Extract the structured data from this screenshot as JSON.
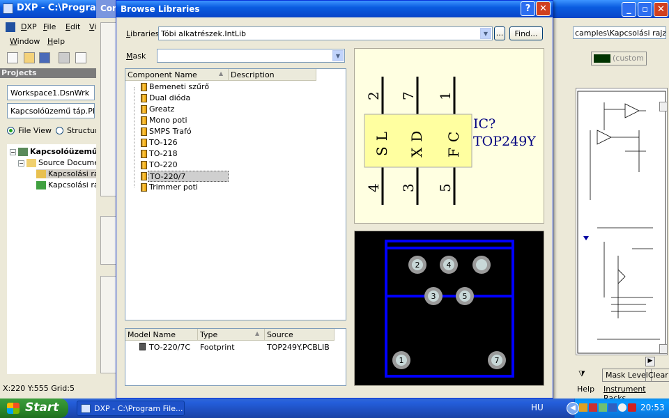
{
  "app": {
    "title": "DXP - C:\\Program",
    "menu": [
      "DXP",
      "File",
      "Edit",
      "Vi",
      "Window",
      "Help"
    ],
    "bg_label": "Con",
    "panel_title": "Projects",
    "workspace": "Workspace1.DsnWrk",
    "project": "Kapcsolóüzemű táp.PRJF",
    "view_file": "File View",
    "view_structure": "Structure",
    "tree": [
      "Kapcsolóüzemű",
      "Source Docume",
      "Kapcsolási raj",
      "Kapcsolási raj"
    ],
    "status": "X:220 Y:555   Grid:5"
  },
  "right_app": {
    "path": "camples\\Kapcsolási rajz",
    "color_label": "(custom",
    "mask_level": "Mask Level",
    "clear": "Clear",
    "help": "Help",
    "instrument_racks": "Instrument Racks"
  },
  "dialog": {
    "title": "Browse Libraries",
    "libraries_label": "Libraries",
    "libraries_value": "Tóbi alkatrészek.IntLib",
    "find_button": "Find...",
    "ellipsis": "...",
    "mask_label": "Mask",
    "mask_value": "",
    "components": {
      "headers": [
        "Component Name",
        "Description"
      ],
      "items": [
        "Bemeneti szűrő",
        "Dual dióda",
        "Greatz",
        "Mono poti",
        "SMPS Trafó",
        "TO-126",
        "TO-218",
        "TO-220",
        "TO-220/7",
        "Trimmer poti"
      ],
      "selected": "TO-220/7"
    },
    "models": {
      "headers": [
        "Model Name",
        "Type",
        "Source"
      ],
      "rows": [
        {
          "name": "TO-220/7C",
          "type": "Footprint",
          "source": "TOP249Y.PCBLIB"
        }
      ]
    },
    "symbol": {
      "designator": "IC?",
      "part": "TOP249Y",
      "pins_top": [
        "2",
        "7",
        "1"
      ],
      "pins_bottom": [
        "4",
        "3",
        "5"
      ],
      "pin_names": [
        "SL",
        "XD",
        "FC"
      ]
    },
    "footprint": {
      "pads": [
        {
          "label": "2",
          "shape": "circle"
        },
        {
          "label": "4",
          "shape": "circle"
        },
        {
          "label": "",
          "shape": "circle"
        },
        {
          "label": "3",
          "shape": "circle"
        },
        {
          "label": "5",
          "shape": "circle"
        },
        {
          "label": "1",
          "shape": "circle"
        },
        {
          "label": "7",
          "shape": "circle"
        }
      ]
    }
  },
  "taskbar": {
    "start": "Start",
    "task": "DXP - C:\\Program File...",
    "lang": "HU",
    "clock": "20:53"
  },
  "colors": {
    "accent": "#0a5ce0",
    "pcb_track": "#0000ff",
    "symbol_body": "#ffffa0",
    "symbol_text": "#000080"
  }
}
